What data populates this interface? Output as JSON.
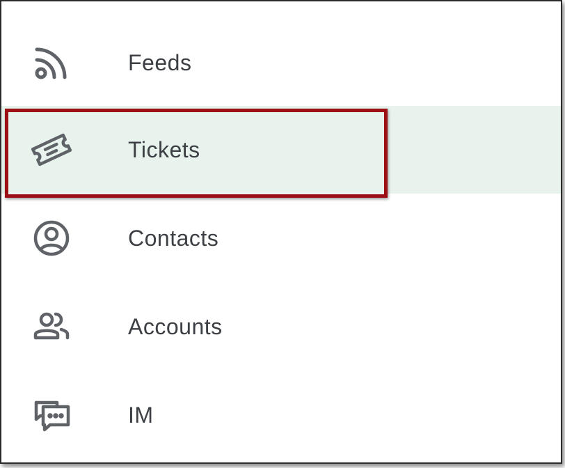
{
  "nav": {
    "items": [
      {
        "label": "Feeds",
        "icon": "rss-feed-icon"
      },
      {
        "label": "Tickets",
        "icon": "ticket-icon",
        "selected": true
      },
      {
        "label": "Contacts",
        "icon": "account-circle-icon"
      },
      {
        "label": "Accounts",
        "icon": "people-icon"
      },
      {
        "label": "IM",
        "icon": "chat-bubbles-icon"
      }
    ]
  },
  "colors": {
    "selected_background": "#e8f3ee",
    "highlight_border": "#9b0f15",
    "icon": "#5f6368",
    "text": "#3c3f43"
  }
}
